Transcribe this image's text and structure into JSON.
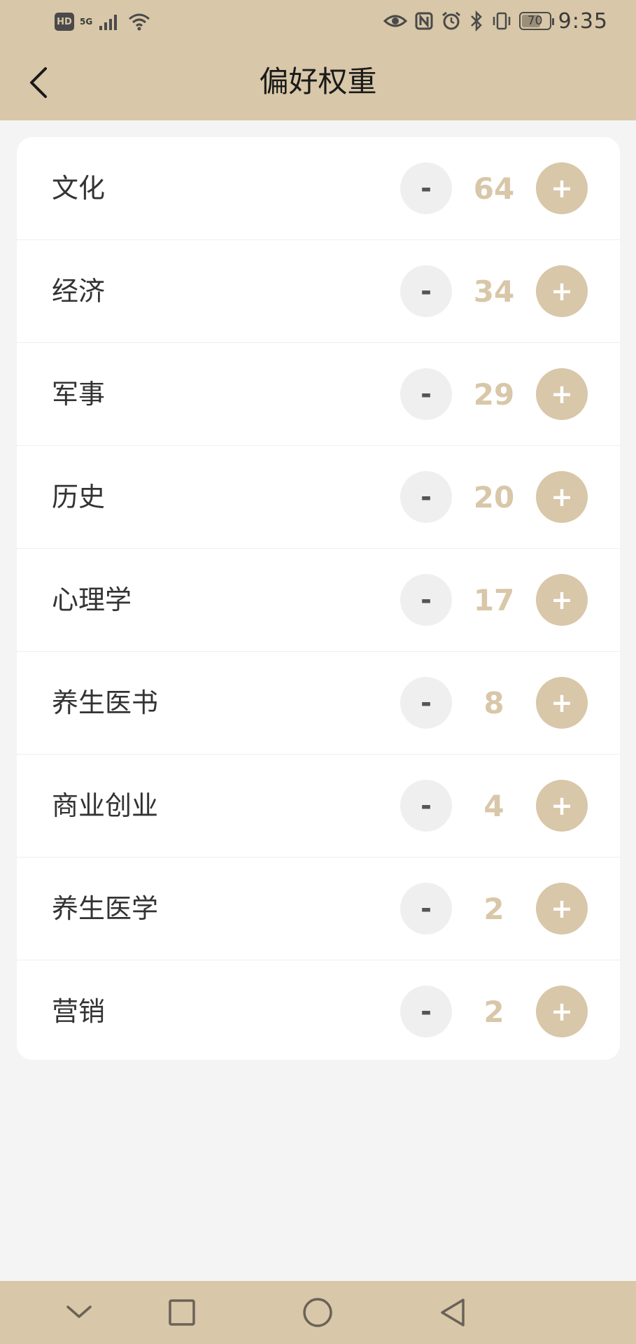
{
  "status_bar": {
    "hd": "HD",
    "network": "5G",
    "battery_level": "70",
    "battery_fraction": 0.7,
    "time": "9:35"
  },
  "header": {
    "title": "偏好权重"
  },
  "preferences": [
    {
      "label": "文化",
      "value": "64",
      "minus": "-",
      "plus": "+"
    },
    {
      "label": "经济",
      "value": "34",
      "minus": "-",
      "plus": "+"
    },
    {
      "label": "军事",
      "value": "29",
      "minus": "-",
      "plus": "+"
    },
    {
      "label": "历史",
      "value": "20",
      "minus": "-",
      "plus": "+"
    },
    {
      "label": "心理学",
      "value": "17",
      "minus": "-",
      "plus": "+"
    },
    {
      "label": "养生医书",
      "value": "8",
      "minus": "-",
      "plus": "+"
    },
    {
      "label": "商业创业",
      "value": "4",
      "minus": "-",
      "plus": "+"
    },
    {
      "label": "养生医学",
      "value": "2",
      "minus": "-",
      "plus": "+"
    },
    {
      "label": "营销",
      "value": "2",
      "minus": "-",
      "plus": "+"
    }
  ],
  "icons": {
    "back": "chevron-left-icon",
    "nav": [
      "chevron-down-icon",
      "square-icon",
      "circle-icon",
      "triangle-back-icon"
    ]
  },
  "colors": {
    "accent": "#d8c7a8",
    "background": "#f4f4f4",
    "card": "#ffffff",
    "minus_button": "#efefef"
  }
}
